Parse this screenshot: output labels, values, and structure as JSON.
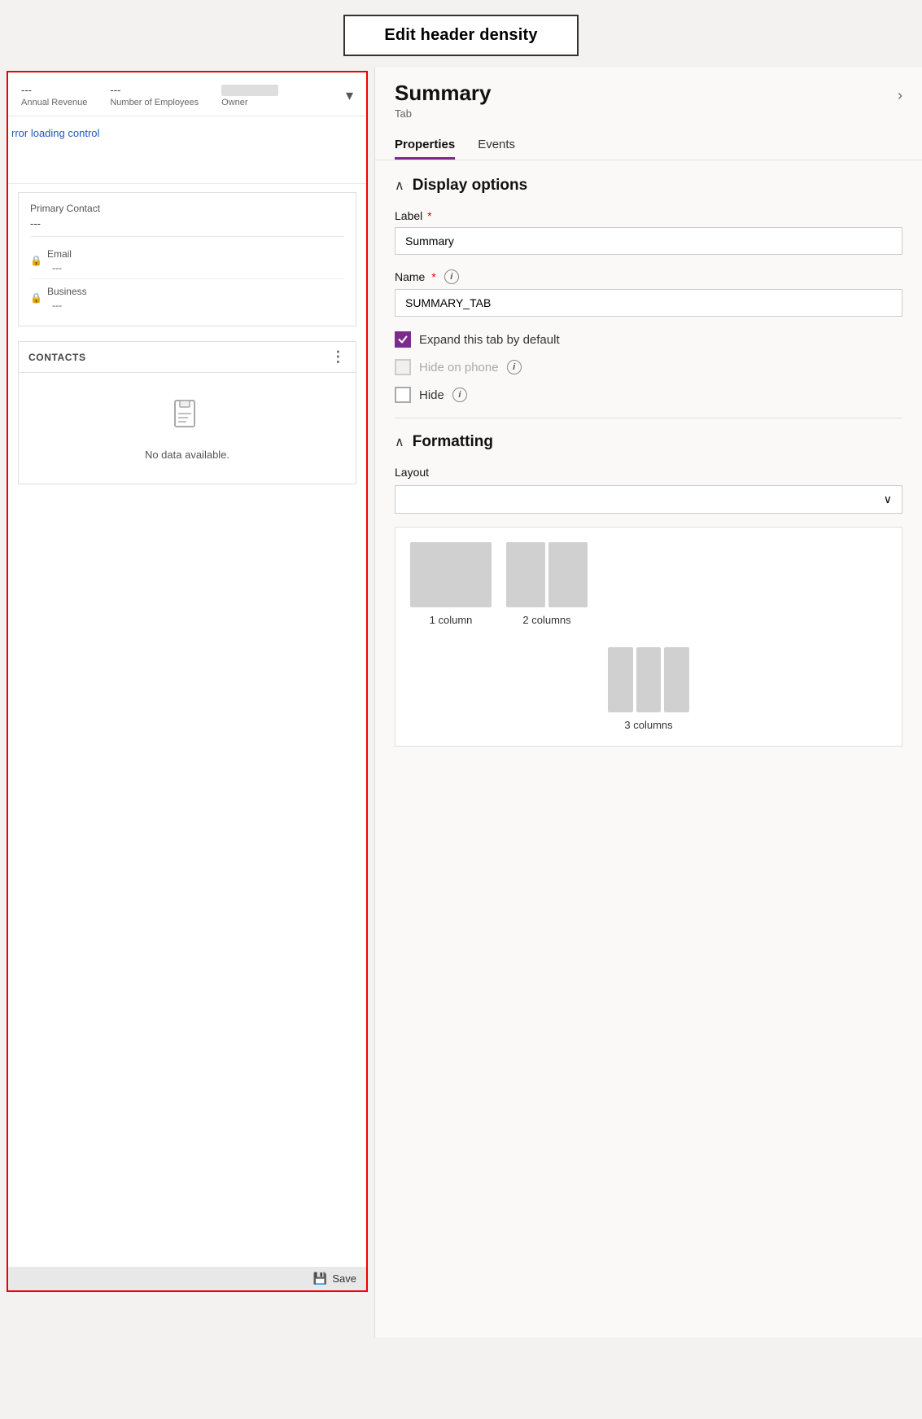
{
  "topBar": {
    "editHeaderBtn": "Edit header density"
  },
  "leftPanel": {
    "headerFields": [
      {
        "value": "---",
        "label": "Annual Revenue"
      },
      {
        "value": "---",
        "label": "Number of Employees"
      }
    ],
    "ownerLabel": "Owner",
    "chevronLabel": "▾",
    "errorLink": "rror loading control",
    "primaryContact": {
      "label": "Primary Contact",
      "value": "---"
    },
    "emailField": {
      "label": "Email",
      "value": "---"
    },
    "businessField": {
      "label": "Business",
      "value": "---"
    },
    "contactsSection": {
      "header": "CONTACTS",
      "noDataText": "No data available."
    },
    "saveBtn": "Save"
  },
  "rightPanel": {
    "title": "Summary",
    "subtitle": "Tab",
    "chevron": "›",
    "tabs": [
      {
        "label": "Properties",
        "active": true
      },
      {
        "label": "Events",
        "active": false
      }
    ],
    "displayOptions": {
      "sectionTitle": "Display options",
      "labelField": {
        "label": "Label",
        "required": true,
        "value": "Summary"
      },
      "nameField": {
        "label": "Name",
        "required": true,
        "value": "SUMMARY_TAB"
      },
      "expandCheckbox": {
        "label": "Expand this tab by default",
        "checked": true
      },
      "hideOnPhoneCheckbox": {
        "label": "Hide on phone",
        "checked": false,
        "disabled": true
      },
      "hideCheckbox": {
        "label": "Hide",
        "checked": false,
        "disabled": false
      }
    },
    "formatting": {
      "sectionTitle": "Formatting",
      "layoutLabel": "Layout",
      "layoutOptions": [
        {
          "label": "1 column",
          "type": "1col"
        },
        {
          "label": "2 columns",
          "type": "2col"
        },
        {
          "label": "3 columns",
          "type": "3col"
        }
      ]
    }
  }
}
